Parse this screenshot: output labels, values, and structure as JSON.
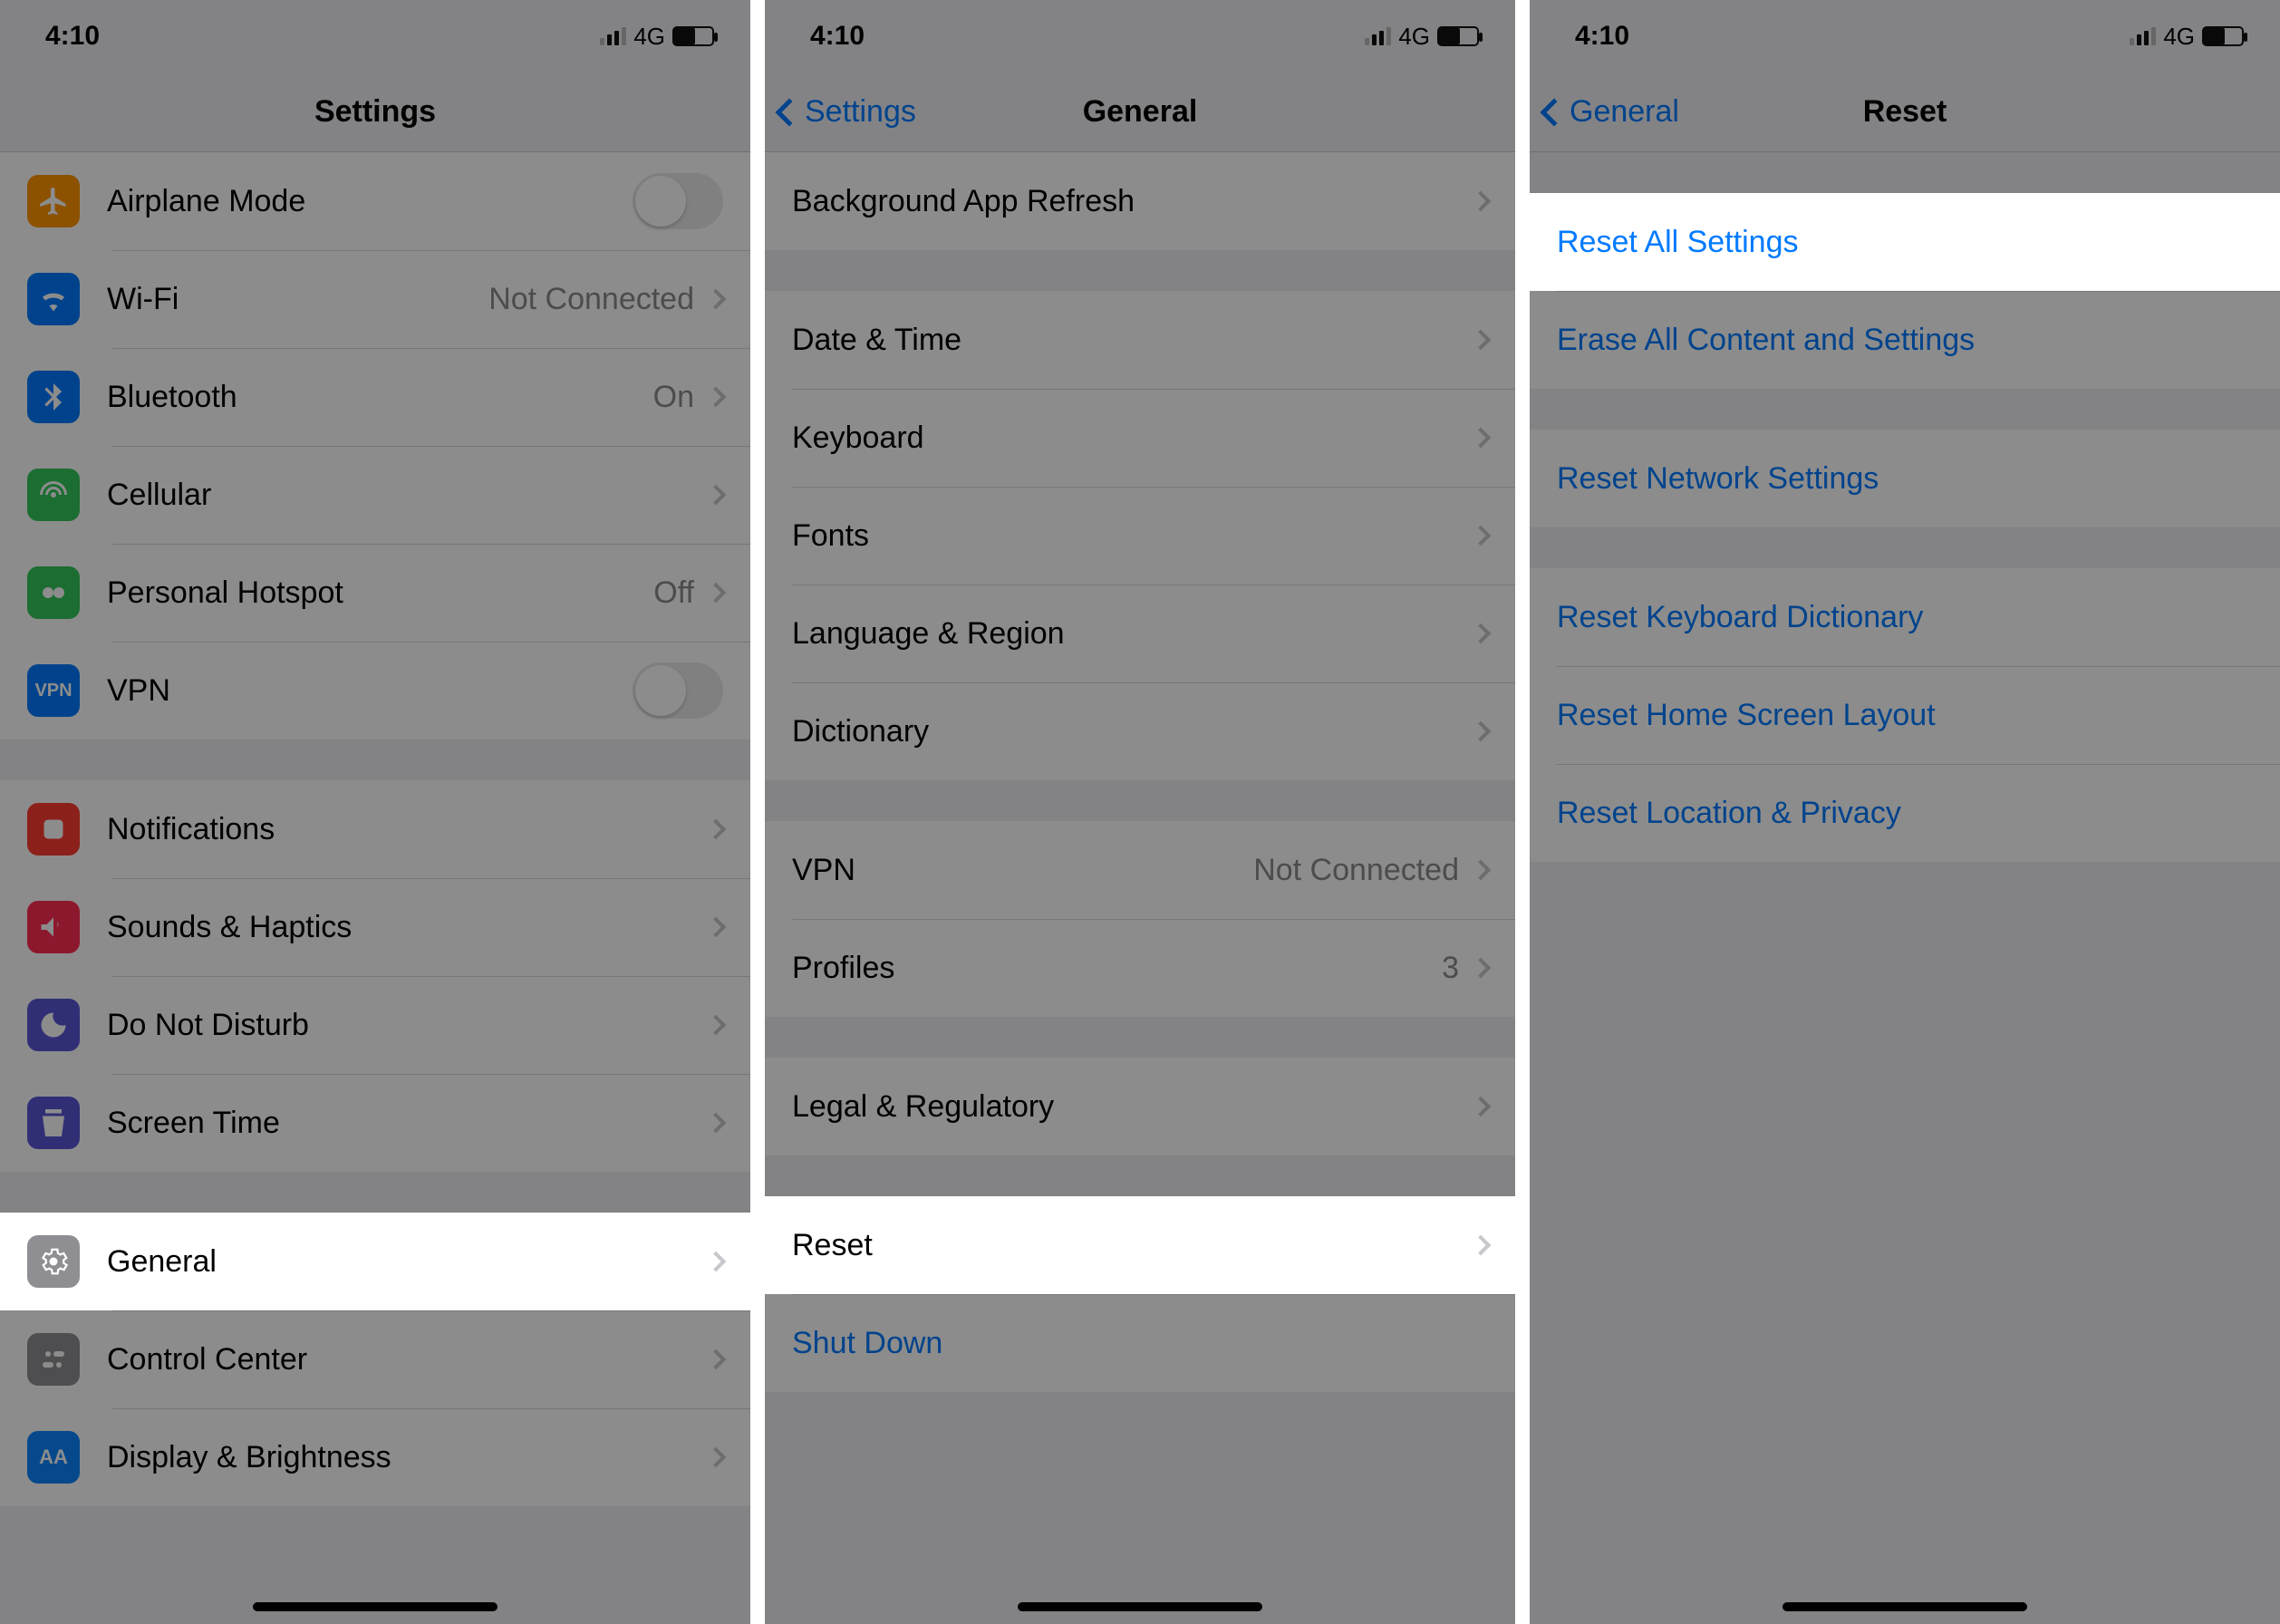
{
  "status": {
    "time": "4:10",
    "network_label": "4G"
  },
  "panel1": {
    "nav_title": "Settings",
    "groups": [
      {
        "cells": [
          {
            "icon": "airplane-icon",
            "icon_color": "ic-orange",
            "label": "Airplane Mode",
            "toggle": true,
            "toggle_on": false
          },
          {
            "icon": "wifi-icon",
            "icon_color": "ic-blue",
            "label": "Wi-Fi",
            "value": "Not Connected",
            "chevron": true
          },
          {
            "icon": "bluetooth-icon",
            "icon_color": "ic-blue",
            "label": "Bluetooth",
            "value": "On",
            "chevron": true
          },
          {
            "icon": "cellular-icon",
            "icon_color": "ic-green",
            "label": "Cellular",
            "chevron": true
          },
          {
            "icon": "hotspot-icon",
            "icon_color": "ic-green",
            "label": "Personal Hotspot",
            "value": "Off",
            "chevron": true
          },
          {
            "icon": "vpn-icon",
            "icon_color": "ic-vpn",
            "label": "VPN",
            "toggle": true,
            "toggle_on": false
          }
        ]
      },
      {
        "cells": [
          {
            "icon": "notifications-icon",
            "icon_color": "ic-red",
            "label": "Notifications",
            "chevron": true
          },
          {
            "icon": "sounds-icon",
            "icon_color": "ic-pink",
            "label": "Sounds & Haptics",
            "chevron": true
          },
          {
            "icon": "dnd-icon",
            "icon_color": "ic-purple",
            "label": "Do Not Disturb",
            "chevron": true
          },
          {
            "icon": "screentime-icon",
            "icon_color": "ic-purple",
            "label": "Screen Time",
            "chevron": true
          }
        ]
      },
      {
        "cells": [
          {
            "icon": "general-icon",
            "icon_color": "ic-gray",
            "label": "General",
            "chevron": true,
            "highlight": true
          },
          {
            "icon": "controlcenter-icon",
            "icon_color": "ic-gray",
            "label": "Control Center",
            "chevron": true
          },
          {
            "icon": "display-icon",
            "icon_color": "ic-dblue",
            "label": "Display & Brightness",
            "chevron": true
          }
        ]
      }
    ]
  },
  "panel2": {
    "nav_back": "Settings",
    "nav_title": "General",
    "groups": [
      {
        "cells": [
          {
            "label": "Background App Refresh",
            "chevron": true
          }
        ]
      },
      {
        "cells": [
          {
            "label": "Date & Time",
            "chevron": true
          },
          {
            "label": "Keyboard",
            "chevron": true
          },
          {
            "label": "Fonts",
            "chevron": true
          },
          {
            "label": "Language & Region",
            "chevron": true
          },
          {
            "label": "Dictionary",
            "chevron": true
          }
        ]
      },
      {
        "cells": [
          {
            "label": "VPN",
            "value": "Not Connected",
            "chevron": true
          },
          {
            "label": "Profiles",
            "value": "3",
            "chevron": true
          }
        ]
      },
      {
        "cells": [
          {
            "label": "Legal & Regulatory",
            "chevron": true
          }
        ]
      },
      {
        "cells": [
          {
            "label": "Reset",
            "chevron": true,
            "highlight": true
          },
          {
            "label": "Shut Down",
            "blue": true
          }
        ]
      }
    ]
  },
  "panel3": {
    "nav_back": "General",
    "nav_title": "Reset",
    "groups": [
      {
        "cells": [
          {
            "label": "Reset All Settings",
            "blue": true,
            "highlight": true
          },
          {
            "label": "Erase All Content and Settings",
            "blue": true
          }
        ]
      },
      {
        "cells": [
          {
            "label": "Reset Network Settings",
            "blue": true
          }
        ]
      },
      {
        "cells": [
          {
            "label": "Reset Keyboard Dictionary",
            "blue": true
          },
          {
            "label": "Reset Home Screen Layout",
            "blue": true
          },
          {
            "label": "Reset Location & Privacy",
            "blue": true
          }
        ]
      }
    ]
  }
}
